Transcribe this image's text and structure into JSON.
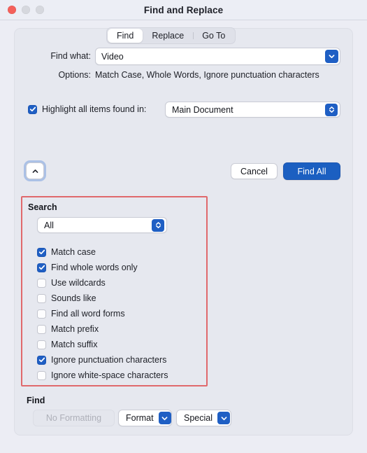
{
  "window": {
    "title": "Find and Replace",
    "traffic_lights": [
      "close",
      "minimize",
      "maximize"
    ],
    "accent_blue": "#1f5fc4",
    "annotation_red": "#e0696c"
  },
  "tabs": [
    {
      "label": "Find",
      "selected": true
    },
    {
      "label": "Replace",
      "selected": false
    },
    {
      "label": "Go To",
      "selected": false
    }
  ],
  "find": {
    "find_what_label": "Find what:",
    "find_what_value": "Video",
    "options_label": "Options:",
    "options_value": "Match Case, Whole Words, Ignore punctuation characters"
  },
  "highlight": {
    "label": "Highlight all items found in:",
    "checked": true,
    "scope_value": "Main Document"
  },
  "actions": {
    "disclosure_icon": "chevron-up-icon",
    "cancel_label": "Cancel",
    "find_all_label": "Find All"
  },
  "search_section": {
    "title": "Search",
    "scope_value": "All",
    "checkboxes": [
      {
        "label": "Match case",
        "checked": true
      },
      {
        "label": "Find whole words only",
        "checked": true
      },
      {
        "label": "Use wildcards",
        "checked": false
      },
      {
        "label": "Sounds like",
        "checked": false
      },
      {
        "label": "Find all word forms",
        "checked": false
      },
      {
        "label": "Match prefix",
        "checked": false
      },
      {
        "label": "Match suffix",
        "checked": false
      },
      {
        "label": "Ignore punctuation characters",
        "checked": true
      },
      {
        "label": "Ignore white-space characters",
        "checked": false
      }
    ]
  },
  "find_section": {
    "title": "Find",
    "no_formatting_label": "No Formatting",
    "format_label": "Format",
    "special_label": "Special"
  }
}
